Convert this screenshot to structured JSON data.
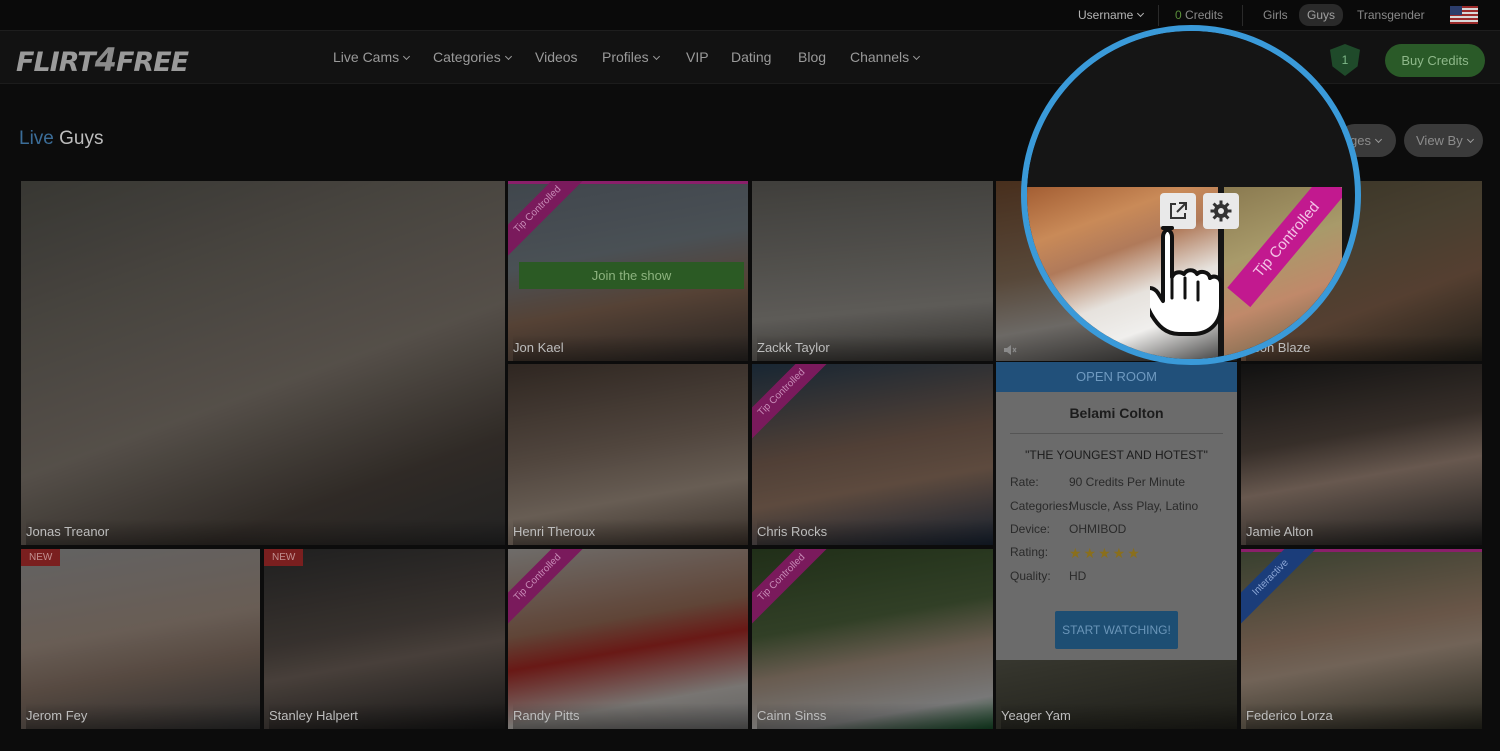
{
  "topbar": {
    "username": "Username",
    "credits_count": "0",
    "credits_label": "Credits",
    "categories": [
      "Girls",
      "Guys",
      "Transgender"
    ],
    "active_category": "Guys",
    "flag_icon": "us-flag-icon"
  },
  "header": {
    "logo": {
      "part1": "FLIRT",
      "part2": "4",
      "part3": "FREE"
    },
    "nav": [
      {
        "label": "Live Cams",
        "dropdown": true
      },
      {
        "label": "Categories",
        "dropdown": true
      },
      {
        "label": "Videos",
        "dropdown": false
      },
      {
        "label": "Profiles",
        "dropdown": true
      },
      {
        "label": "VIP",
        "dropdown": false
      },
      {
        "label": "Dating",
        "dropdown": false
      },
      {
        "label": "Blog",
        "dropdown": false
      },
      {
        "label": "Channels",
        "dropdown": true
      }
    ],
    "level_badge": "1",
    "buy_credits": "Buy Credits"
  },
  "section": {
    "title_live": "Live",
    "title_rest": "Guys",
    "languages_partial": "ges",
    "view_by": "View By"
  },
  "performers": [
    {
      "name": "Jonas Treanor"
    },
    {
      "name": "Jon Kael",
      "badge": "Tip Controlled",
      "action": "Join the show"
    },
    {
      "name": "Zackk Taylor"
    },
    {
      "name": "",
      "muted": true
    },
    {
      "name": "ason Blaze",
      "badge": "Tip Controlled"
    },
    {
      "name": "Henri Theroux"
    },
    {
      "name": "Chris Rocks",
      "badge": "Tip Controlled"
    },
    {
      "name": "Jamie Alton"
    },
    {
      "name": "Jerom Fey",
      "tag": "NEW"
    },
    {
      "name": "Stanley Halpert",
      "tag": "NEW"
    },
    {
      "name": "Randy Pitts",
      "badge": "Tip Controlled"
    },
    {
      "name": "Cainn Sinss",
      "badge": "Tip Controlled"
    },
    {
      "name": "Yeager Yam"
    },
    {
      "name": "Federico Lorza",
      "badge": "Interactive"
    }
  ],
  "hover_card": {
    "header": "OPEN ROOM",
    "name": "Belami Colton",
    "tagline": "\"THE YOUNGEST AND HOTEST\"",
    "rate_label": "Rate:",
    "rate": "90 Credits Per Minute",
    "categories_label": "Categories:",
    "categories": "Muscle, Ass Play, Latino",
    "device_label": "Device:",
    "device": "OHMIBOD",
    "rating_label": "Rating:",
    "rating": 5,
    "rating_stars": "★★★★★",
    "quality_label": "Quality:",
    "quality": "HD",
    "cta": "START WATCHING!"
  },
  "magnifier": {
    "badge": "Tip Controlled",
    "icons": [
      "popout-icon",
      "gear-icon",
      "hand-pointer-icon"
    ]
  },
  "colors": {
    "accent_blue": "#3a9ad9",
    "green": "#2a5a28",
    "pink_ribbon": "#c2198f",
    "blue_ribbon": "#1f5bd1"
  }
}
